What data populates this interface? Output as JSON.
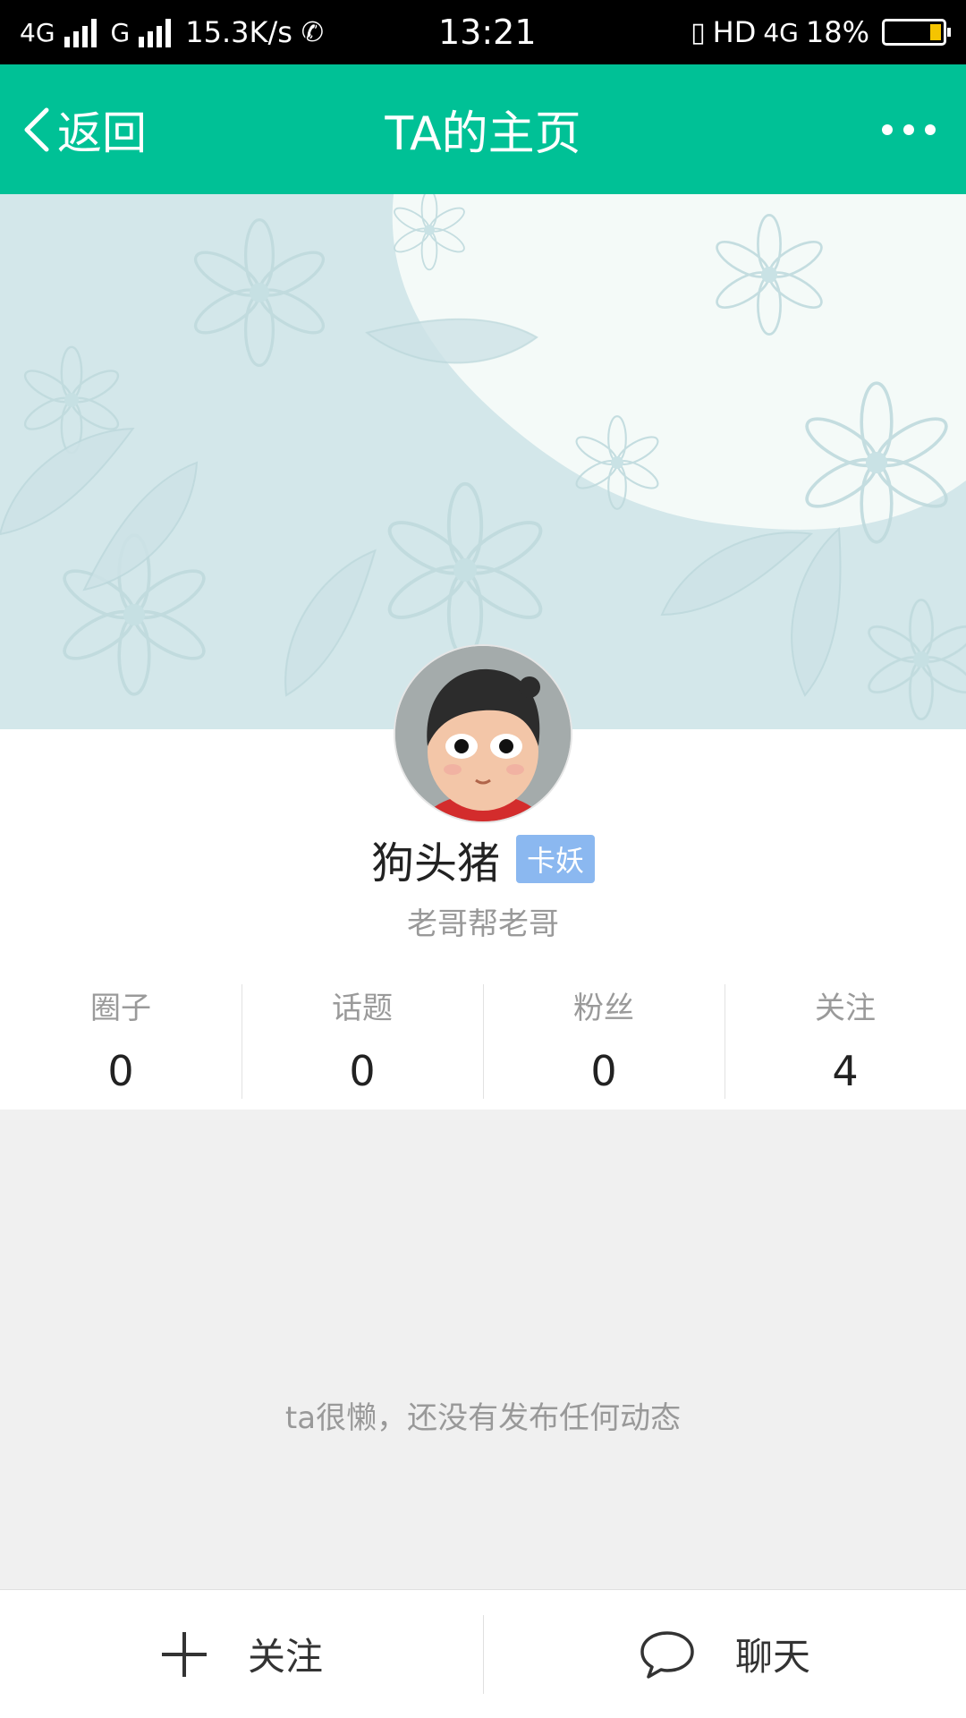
{
  "status_bar": {
    "network1": "4G",
    "network2": "G",
    "speed": "15.3K/s",
    "time": "13:21",
    "hd": "HD",
    "network3": "4G",
    "battery": "18%"
  },
  "header": {
    "back_label": "返回",
    "title": "TA的主页"
  },
  "profile": {
    "name": "狗头猪",
    "badge": "卡妖",
    "signature": "老哥帮老哥"
  },
  "stats": [
    {
      "label": "圈子",
      "value": "0"
    },
    {
      "label": "话题",
      "value": "0"
    },
    {
      "label": "粉丝",
      "value": "0"
    },
    {
      "label": "关注",
      "value": "4"
    }
  ],
  "empty_message": "ta很懒，还没有发布任何动态",
  "bottom": {
    "follow_label": "关注",
    "chat_label": "聊天"
  },
  "colors": {
    "accent": "#00c196",
    "badge": "#8bb8f0",
    "cover": "#d4e8ea"
  },
  "icons": {
    "back": "chevron-left-icon",
    "more": "more-dots-icon",
    "follow": "plus-icon",
    "chat": "chat-bubble-icon"
  }
}
